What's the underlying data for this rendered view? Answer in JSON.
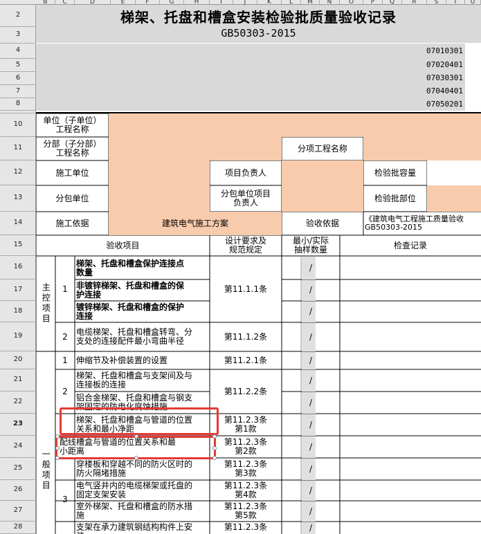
{
  "colors": {
    "header_bg": "#e6e6e6",
    "orange_fill": "#f8cbad",
    "gray_fill": "#d9d9d9",
    "grid": "#c8c8c8",
    "border": "#000000",
    "selection": "#e53935"
  },
  "column_headers": [
    "B",
    "C",
    "D",
    "E",
    "F",
    "G",
    "H",
    "I",
    "J",
    "K",
    "L",
    "M",
    "N",
    "O",
    "P",
    "Q",
    "R",
    "S",
    "T",
    "U"
  ],
  "row_numbers": [
    "2",
    "3",
    "4",
    "5",
    "6",
    "7",
    "8",
    "9",
    "10",
    "11",
    "12",
    "13",
    "14",
    "15",
    "16",
    "17",
    "18",
    "19",
    "20",
    "21",
    "22",
    "23",
    "24",
    "25",
    "26",
    "27",
    "28"
  ],
  "title": "梯架、托盘和槽盒安装检验批质量验收记录",
  "standard": "GB50303-2015",
  "codes": [
    "07010301",
    "07020401",
    "07030301",
    "07040401",
    "07050201"
  ],
  "form": {
    "unit_name_label": "单位（子单位）\n工程名称",
    "division_label": "分部（子分部）\n工程名称",
    "subitem_label": "分项工程名称",
    "construction_unit_label": "施工单位",
    "pm_label": "项目负责人",
    "lot_capacity_label": "检验批容量",
    "subcontract_unit_label": "分包单位",
    "subcontract_pm_label": "分包单位项目\n负责人",
    "lot_location_label": "检验批部位",
    "basis_label": "施工依据",
    "basis_value": "建筑电气施工方案",
    "acceptance_basis_label": "验收依据",
    "acceptance_basis_value": "《建筑电气工程施工质量验收\nGB50303-2015"
  },
  "table": {
    "header_item": "验收项目",
    "header_requirement": "设计要求及\n规范规定",
    "header_sample": "最小/实际\n抽样数量",
    "header_record": "检查记录",
    "main_group": "主控项目",
    "general_group": "一般项目",
    "slash": "/",
    "main_items": [
      {
        "no": "1",
        "req": "第11.1.1条",
        "subs": [
          "梯架、托盘和槽盒保护连接点\n数量",
          "非镀锌梯架、托盘和槽盒的保\n护连接",
          "镀锌梯架、托盘和槽盒的保护\n连接"
        ]
      },
      {
        "no": "2",
        "req": "第11.1.2条",
        "subs": [
          "电缆梯架、托盘和槽盒转弯、分\n支处的连接配件最小弯曲半径"
        ]
      }
    ],
    "general_items": [
      {
        "no": "1",
        "text": "伸缩节及补偿装置的设置",
        "req": "第11.2.1条"
      },
      {
        "no": "2",
        "req": "第11.2.2条",
        "subs": [
          "梯架、托盘和槽盒与支架间及与\n连接板的连接",
          "铝合金梯架、托盘和槽盒与钢支\n架固定的防电化腐蚀措施"
        ]
      },
      {
        "text": "梯架、托盘和槽盒与管道的位置\n关系和最小净距",
        "req": "第11.2.3条\n第1款"
      },
      {
        "text": "配线槽盒与管道的位置关系和最\n小距离",
        "req": "第11.2.3条\n第2款"
      },
      {
        "no": "3",
        "text": "穿楼板和穿越不同的防火区时的\n防火隔堵措施",
        "req": "第11.2.3条\n第3款"
      },
      {
        "text": "电气竖井内的电缆梯架或托盘的\n固定支架安装",
        "req": "第11.2.3条\n第4款"
      },
      {
        "text": "室外梯架、托盘和槽盒的防水措\n施",
        "req": "第11.2.3条\n第5款"
      },
      {
        "text": "支架在承力建筑钢结构构件上安\n装",
        "req": "第11.2.3条"
      }
    ]
  }
}
